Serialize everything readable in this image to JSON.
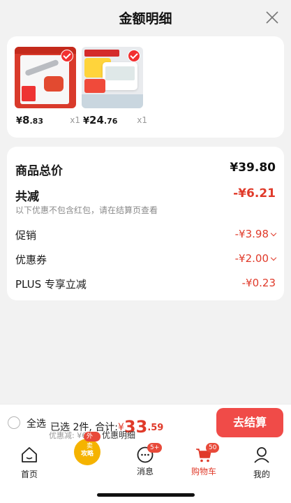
{
  "header": {
    "title": "金额明细"
  },
  "products": [
    {
      "price_symbol": "¥",
      "price_int": "8",
      "price_dec": ".83",
      "qty": "x1"
    },
    {
      "price_symbol": "¥",
      "price_int": "24",
      "price_dec": ".76",
      "qty": "x1"
    }
  ],
  "summary": {
    "total_label": "商品总价",
    "total_value": "¥39.80",
    "discount_label": "共减",
    "discount_value": "-¥6.21",
    "note": "以下优惠不包含红包，请在结算页查看",
    "items": [
      {
        "label": "促销",
        "value": "-¥3.98"
      },
      {
        "label": "优惠券",
        "value": "-¥2.00"
      },
      {
        "label": "PLUS 专享立减",
        "value": "-¥0.23"
      }
    ]
  },
  "checkout": {
    "select_all": "全选",
    "selected_text": "已选 2件, 合计:",
    "currency": "¥",
    "amount_int": "33",
    "amount_dec": ".59",
    "discount_line": "优惠减: ¥6.21",
    "detail_link": "优惠明细",
    "button": "去结算"
  },
  "tabbar": {
    "home": "首页",
    "promo_tag": "外卖",
    "promo_text": "攻略",
    "messages": "消息",
    "messages_badge": "5+",
    "cart": "购物车",
    "cart_badge": "50",
    "mine": "我的"
  },
  "colors": {
    "accent": "#e03a2a",
    "button": "#f04b48"
  }
}
